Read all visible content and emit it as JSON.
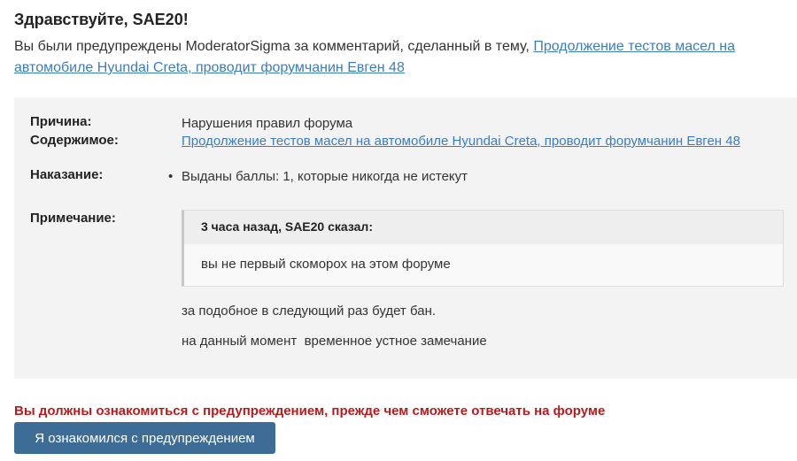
{
  "greeting": "Здравствуйте, SAE20!",
  "intro": {
    "prefix": "Вы были предупреждены ModeratorSigma за комментарий, сделанный в тему, ",
    "topic_link": "Продолжение тестов масел на автомобиле Hyundai Creta, проводит форумчанин Евген 48"
  },
  "details": {
    "reason_label": "Причина:",
    "reason_value": "Нарушения правил форума",
    "content_label": "Содержимое:",
    "content_link": "Продолжение тестов масел на автомобиле Hyundai Creta, проводит форумчанин Евген 48",
    "penalty_label": "Наказание:",
    "penalty_items": [
      "Выданы баллы: 1, которые никогда не истекут"
    ],
    "note_label": "Примечание:",
    "quote_header": "3 часа назад, SAE20 сказал:",
    "quote_text": "вы не первый скоморох на этом форуме",
    "note_lines": [
      "за подобное в следующий раз будет бан.",
      "на данный момент  временное устное замечание"
    ]
  },
  "warning_text": "Вы должны ознакомиться с предупреждением, прежде чем сможете отвечать на форуме",
  "acknowledge_button": "Я ознакомился с предупреждением",
  "colors": {
    "link": "#3b7dc4",
    "warning": "#b81b1b",
    "button": "#3d6d96",
    "panel": "#f3f3f3"
  }
}
